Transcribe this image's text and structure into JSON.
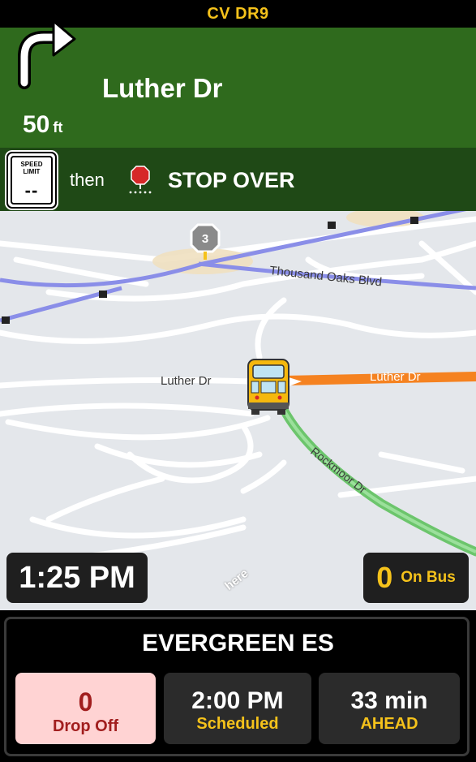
{
  "header": {
    "route_name": "CV DR9"
  },
  "maneuver": {
    "icon": "turn-right-arrow-icon",
    "distance_value": "50",
    "distance_unit": "ft",
    "street": "Luther Dr"
  },
  "next_maneuver": {
    "speed_limit_label": "SPEED LIMIT",
    "speed_limit_value": "--",
    "then_text": "then",
    "icon": "stop-sign-marker-icon",
    "label": "STOP OVER"
  },
  "map": {
    "stop_marker_number": "3",
    "street_labels": [
      "Thousand Oaks Blvd",
      "Luther Dr",
      "Luther Dr",
      "Rockmoor Dr"
    ],
    "route_color": "#f58220",
    "traveled_color": "#6cc56c",
    "attribution": "here"
  },
  "status": {
    "time": "1:25 PM",
    "on_bus_count": "0",
    "on_bus_label": "On Bus"
  },
  "destination": {
    "name": "EVERGREEN ES",
    "drop_off_count": "0",
    "drop_off_label": "Drop Off",
    "scheduled_time": "2:00 PM",
    "scheduled_label": "Scheduled",
    "ahead_value": "33 min",
    "ahead_label": "AHEAD"
  },
  "colors": {
    "accent_yellow": "#f5c21b",
    "nav_green": "#2f6a1d",
    "nav_green_dark": "#1f4916",
    "drop_off_bg": "#ffd3d3"
  }
}
